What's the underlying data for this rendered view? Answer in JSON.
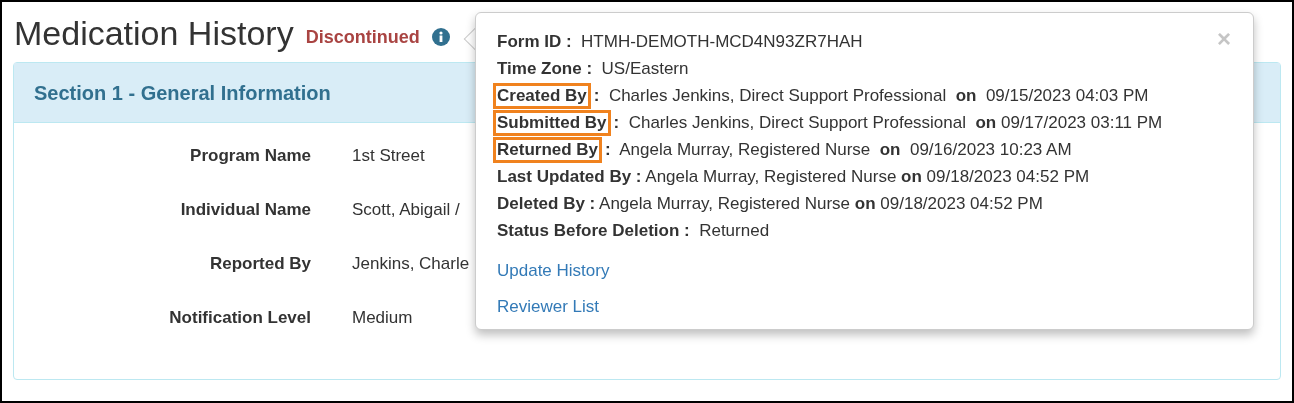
{
  "page": {
    "title": "Medication History",
    "status": "Discontinued"
  },
  "section": {
    "title": "Section 1 - General Information",
    "fields": [
      {
        "label": "Program Name",
        "value": "1st Street"
      },
      {
        "label": "Individual Name",
        "value": "Scott, Abigail /"
      },
      {
        "label": "Reported By",
        "value": "Jenkins, Charle"
      },
      {
        "label": "Notification Level",
        "value": "Medium"
      }
    ]
  },
  "popover": {
    "close": "×",
    "rows": [
      {
        "label": "Form ID",
        "highlighted": false,
        "text": "**:**  HTMH-DEMOTH-MCD4N93ZR7HAH"
      },
      {
        "label": "Time Zone",
        "highlighted": false,
        "text": "**:**  US/Eastern"
      },
      {
        "label": "Created By",
        "highlighted": true,
        "text": "**:**  Charles Jenkins, Direct Support Professional  **on**  09/15/2023 04:03 PM"
      },
      {
        "label": "Submitted By",
        "highlighted": true,
        "text": "**:**  Charles Jenkins, Direct Support Professional  **on** 09/17/2023 03:11 PM"
      },
      {
        "label": "Returned By",
        "highlighted": true,
        "text": "**:**  Angela Murray, Registered Nurse  **on**  09/16/2023 10:23 AM"
      },
      {
        "label": "Last Updated By",
        "highlighted": false,
        "text": "**:** Angela Murray, Registered Nurse **on** 09/18/2023 04:52 PM"
      },
      {
        "label": "Deleted By",
        "highlighted": false,
        "text": "**:** Angela Murray, Registered Nurse **on** 09/18/2023 04:52 PM"
      },
      {
        "label": "Status Before Deletion",
        "highlighted": false,
        "text": "**:**  Returned"
      }
    ],
    "links": [
      "Update History",
      "Reviewer List"
    ]
  }
}
